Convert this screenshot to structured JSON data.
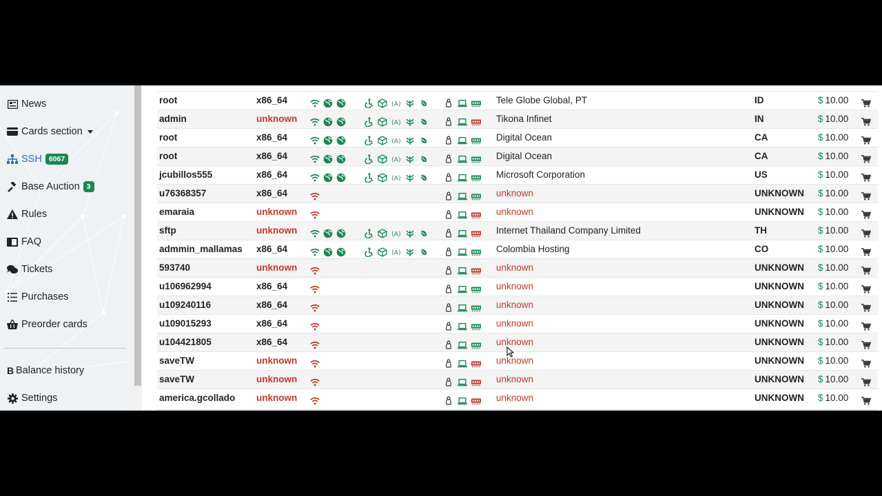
{
  "sidebar": {
    "items": [
      {
        "label": "News",
        "icon": "newspaper-icon"
      },
      {
        "label": "Cards section",
        "icon": "credit-card-icon",
        "dropdown": true
      },
      {
        "label": "SSH",
        "icon": "sitemap-icon",
        "badge": "6067",
        "active": true
      },
      {
        "label": "Base Auction",
        "icon": "gavel-icon",
        "badge": "3"
      },
      {
        "label": "Rules",
        "icon": "warning-icon"
      },
      {
        "label": "FAQ",
        "icon": "question-icon"
      },
      {
        "label": "Tickets",
        "icon": "comments-icon"
      },
      {
        "label": "Purchases",
        "icon": "list-icon"
      },
      {
        "label": "Preorder cards",
        "icon": "shopping-basket-icon"
      },
      {
        "label": "Balance history",
        "icon": "bitcoin-icon"
      },
      {
        "label": "Settings",
        "icon": "gear-icon"
      }
    ]
  },
  "colors": {
    "green": "#198754",
    "red": "#c0392b",
    "link": "#2a6fb8"
  },
  "table": {
    "currency": "$",
    "rows": [
      {
        "user": "root",
        "arch": "x86_64",
        "full": true,
        "memory_red": false,
        "isp": "Tele Globe Global, PT",
        "country": "ID",
        "price": "10.00"
      },
      {
        "user": "admin",
        "arch": "unknown",
        "full": true,
        "memory_red": true,
        "isp": "Tikona Infinet",
        "country": "IN",
        "price": "10.00"
      },
      {
        "user": "root",
        "arch": "x86_64",
        "full": true,
        "memory_red": false,
        "isp": "Digital Ocean",
        "country": "CA",
        "price": "10.00"
      },
      {
        "user": "root",
        "arch": "x86_64",
        "full": true,
        "memory_red": false,
        "isp": "Digital Ocean",
        "country": "CA",
        "price": "10.00"
      },
      {
        "user": "jcubillos555",
        "arch": "x86_64",
        "full": true,
        "memory_red": false,
        "isp": "Microsoft Corporation",
        "country": "US",
        "price": "10.00"
      },
      {
        "user": "u76368357",
        "arch": "x86_64",
        "full": false,
        "memory_red": false,
        "isp": "unknown",
        "country": "UNKNOWN",
        "price": "10.00"
      },
      {
        "user": "emaraia",
        "arch": "unknown",
        "full": false,
        "memory_red": true,
        "isp": "unknown",
        "country": "UNKNOWN",
        "price": "10.00"
      },
      {
        "user": "sftp",
        "arch": "unknown",
        "full": true,
        "memory_red": true,
        "isp": "Internet Thailand Company Limited",
        "country": "TH",
        "price": "10.00"
      },
      {
        "user": "admmin_mallamas",
        "arch": "x86_64",
        "full": true,
        "memory_red": false,
        "isp": "Colombia Hosting",
        "country": "CO",
        "price": "10.00"
      },
      {
        "user": "593740",
        "arch": "unknown",
        "full": false,
        "memory_red": true,
        "isp": "unknown",
        "country": "UNKNOWN",
        "price": "10.00"
      },
      {
        "user": "u106962994",
        "arch": "x86_64",
        "full": false,
        "memory_red": false,
        "isp": "unknown",
        "country": "UNKNOWN",
        "price": "10.00"
      },
      {
        "user": "u109240116",
        "arch": "x86_64",
        "full": false,
        "memory_red": false,
        "isp": "unknown",
        "country": "UNKNOWN",
        "price": "10.00"
      },
      {
        "user": "u109015293",
        "arch": "x86_64",
        "full": false,
        "memory_red": false,
        "isp": "unknown",
        "country": "UNKNOWN",
        "price": "10.00"
      },
      {
        "user": "u104421805",
        "arch": "x86_64",
        "full": false,
        "memory_red": false,
        "isp": "unknown",
        "country": "UNKNOWN",
        "price": "10.00"
      },
      {
        "user": "saveTW",
        "arch": "unknown",
        "full": false,
        "memory_red": true,
        "isp": "unknown",
        "country": "UNKNOWN",
        "price": "10.00"
      },
      {
        "user": "saveTW",
        "arch": "unknown",
        "full": false,
        "memory_red": true,
        "isp": "unknown",
        "country": "UNKNOWN",
        "price": "10.00"
      },
      {
        "user": "america.gcollado",
        "arch": "unknown",
        "full": false,
        "memory_red": true,
        "isp": "unknown",
        "country": "UNKNOWN",
        "price": "10.00"
      }
    ]
  }
}
